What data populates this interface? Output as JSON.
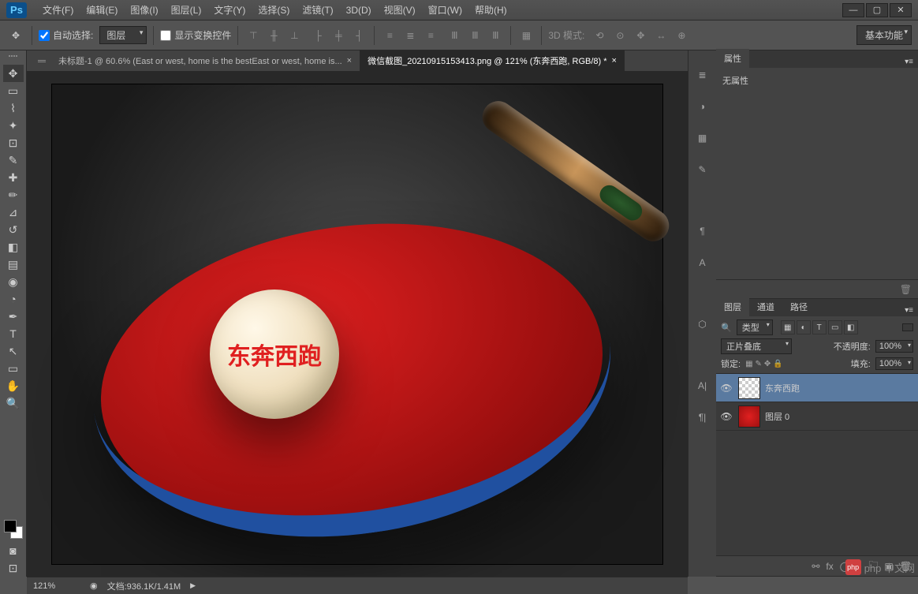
{
  "app": {
    "logo": "Ps"
  },
  "menu": [
    "文件(F)",
    "编辑(E)",
    "图像(I)",
    "图层(L)",
    "文字(Y)",
    "选择(S)",
    "滤镜(T)",
    "3D(D)",
    "视图(V)",
    "窗口(W)",
    "帮助(H)"
  ],
  "options": {
    "auto_select_label": "自动选择:",
    "auto_select_value": "图层",
    "show_transform_label": "显示变换控件",
    "mode_3d_label": "3D 模式:",
    "workspace": "基本功能"
  },
  "tabs": [
    {
      "title": "未标题-1 @ 60.6% (East or west, home is the bestEast or west, home is...",
      "active": false
    },
    {
      "title": "微信截图_20210915153413.png @ 121% (东奔西跑, RGB/8) *",
      "active": true
    }
  ],
  "canvas": {
    "ball_text": "东奔西跑"
  },
  "properties_panel": {
    "tab": "属性",
    "empty_text": "无属性"
  },
  "layers_panel": {
    "tabs": [
      "图层",
      "通道",
      "路径"
    ],
    "kind_label": "类型",
    "blend_mode": "正片叠底",
    "opacity_label": "不透明度:",
    "opacity_value": "100%",
    "lock_label": "锁定:",
    "fill_label": "填充:",
    "fill_value": "100%",
    "layers": [
      {
        "name": "东奔西跑",
        "visible": true,
        "selected": true,
        "thumb": "checker"
      },
      {
        "name": "图层 0",
        "visible": true,
        "selected": false,
        "thumb": "img"
      }
    ]
  },
  "status": {
    "zoom": "121%",
    "doc_info": "文档:936.1K/1.41M"
  },
  "watermark": {
    "text": "php 中文网"
  }
}
